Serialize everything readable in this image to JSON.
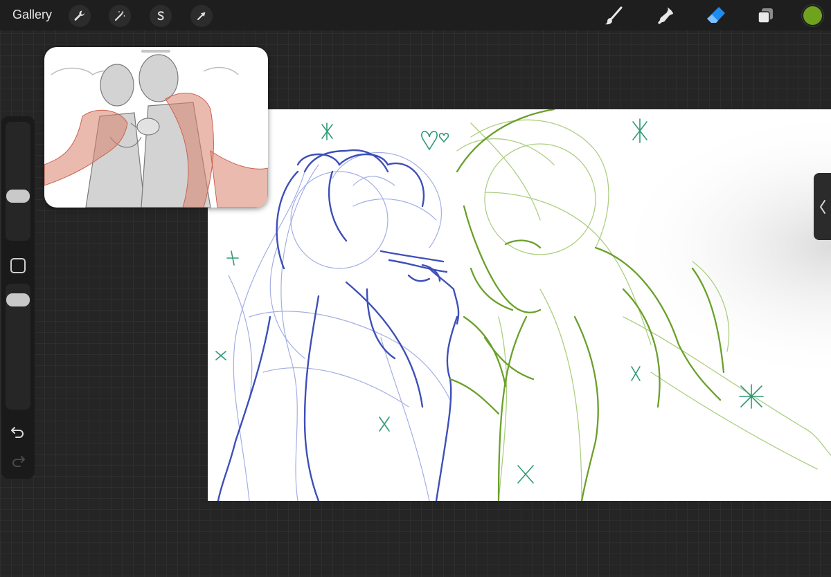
{
  "topbar": {
    "gallery_label": "Gallery",
    "left_tools": [
      "wrench-icon",
      "magic-wand-icon",
      "selection-icon",
      "transform-arrow-icon"
    ],
    "right_tools": [
      "brush-icon",
      "smudge-icon",
      "eraser-icon",
      "layers-icon"
    ],
    "active_tool": "eraser-icon",
    "current_color": "#6fa31d"
  },
  "sidebar": {
    "controls": [
      "brush-size-slider",
      "modify-button",
      "opacity-slider",
      "undo-icon",
      "redo-icon"
    ]
  },
  "canvas": {
    "stroke_colors": {
      "blue": "#3d4fb8",
      "green": "#6aa02a",
      "accent": "#2e9a73"
    }
  },
  "reference": {
    "scarf_color": "#d9826e"
  },
  "panel_tab": {
    "icon": "chevron-left-icon"
  }
}
